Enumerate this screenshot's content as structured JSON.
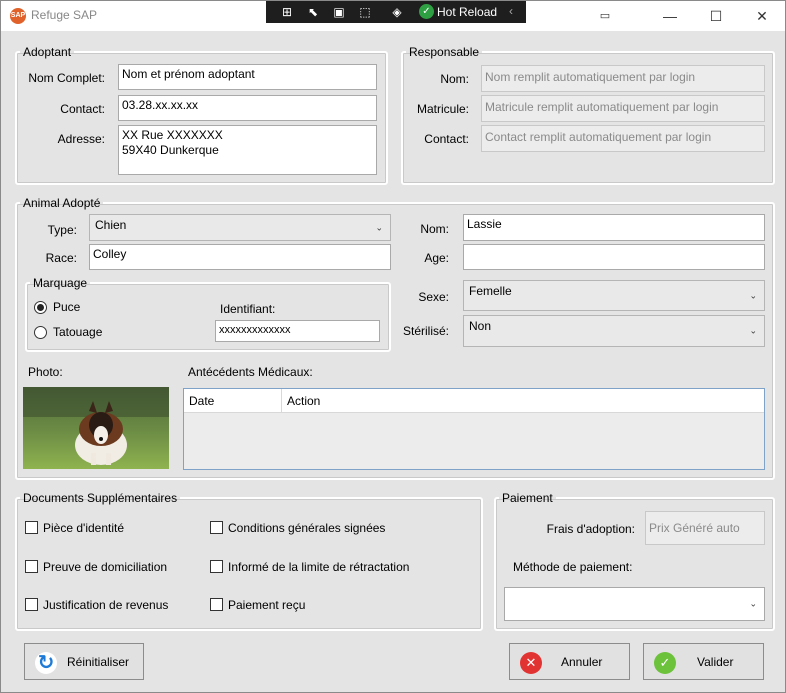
{
  "window": {
    "title": "Refuge SAP",
    "app_icon": "SAP",
    "hot_reload_label": "Hot Reload",
    "accent_color": "#e0622a"
  },
  "adoptant": {
    "legend": "Adoptant",
    "nom_label": "Nom Complet:",
    "nom_value": "Nom et prénom adoptant",
    "contact_label": "Contact:",
    "contact_value": "03.28.xx.xx.xx",
    "adresse_label": "Adresse:",
    "adresse_value": "XX Rue XXXXXXX\n59X40 Dunkerque"
  },
  "responsable": {
    "legend": "Responsable",
    "nom_label": "Nom:",
    "nom_value": "Nom remplit automatiquement par login",
    "matricule_label": "Matricule:",
    "matricule_value": "Matricule remplit automatiquement par login",
    "contact_label": "Contact:",
    "contact_value": "Contact  remplit automatiquement par login"
  },
  "animal": {
    "legend": "Animal Adopté",
    "type_label": "Type:",
    "type_value": "Chien",
    "race_label": "Race:",
    "race_value": "Colley",
    "nom_label": "Nom:",
    "nom_value": "Lassie",
    "age_label": "Age:",
    "age_value": "",
    "sexe_label": "Sexe:",
    "sexe_value": "Femelle",
    "sterilise_label": "Stérilisé:",
    "sterilise_value": "Non",
    "marquage": {
      "legend": "Marquage",
      "option_puce": "Puce",
      "option_tatouage": "Tatouage",
      "selected": "Puce",
      "identifiant_label": "Identifiant:",
      "identifiant_value": "xxxxxxxxxxxxx"
    },
    "photo_label": "Photo:",
    "antecedents_label": "Antécédents Médicaux:",
    "antecedents_columns": [
      "Date",
      "Action"
    ]
  },
  "documents": {
    "legend": "Documents Supplémentaires",
    "items": [
      "Pièce d'identité",
      "Conditions générales signées",
      "Preuve de domiciliation",
      "Informé de la limite de rétractation",
      "Justification de revenus",
      "Paiement reçu"
    ]
  },
  "paiement": {
    "legend": "Paiement",
    "frais_label": "Frais d'adoption:",
    "frais_value": "Prix Généré auto",
    "methode_label": "Méthode de paiement:",
    "methode_value": ""
  },
  "buttons": {
    "reset": "Réinitialiser",
    "cancel": "Annuler",
    "validate": "Valider"
  }
}
